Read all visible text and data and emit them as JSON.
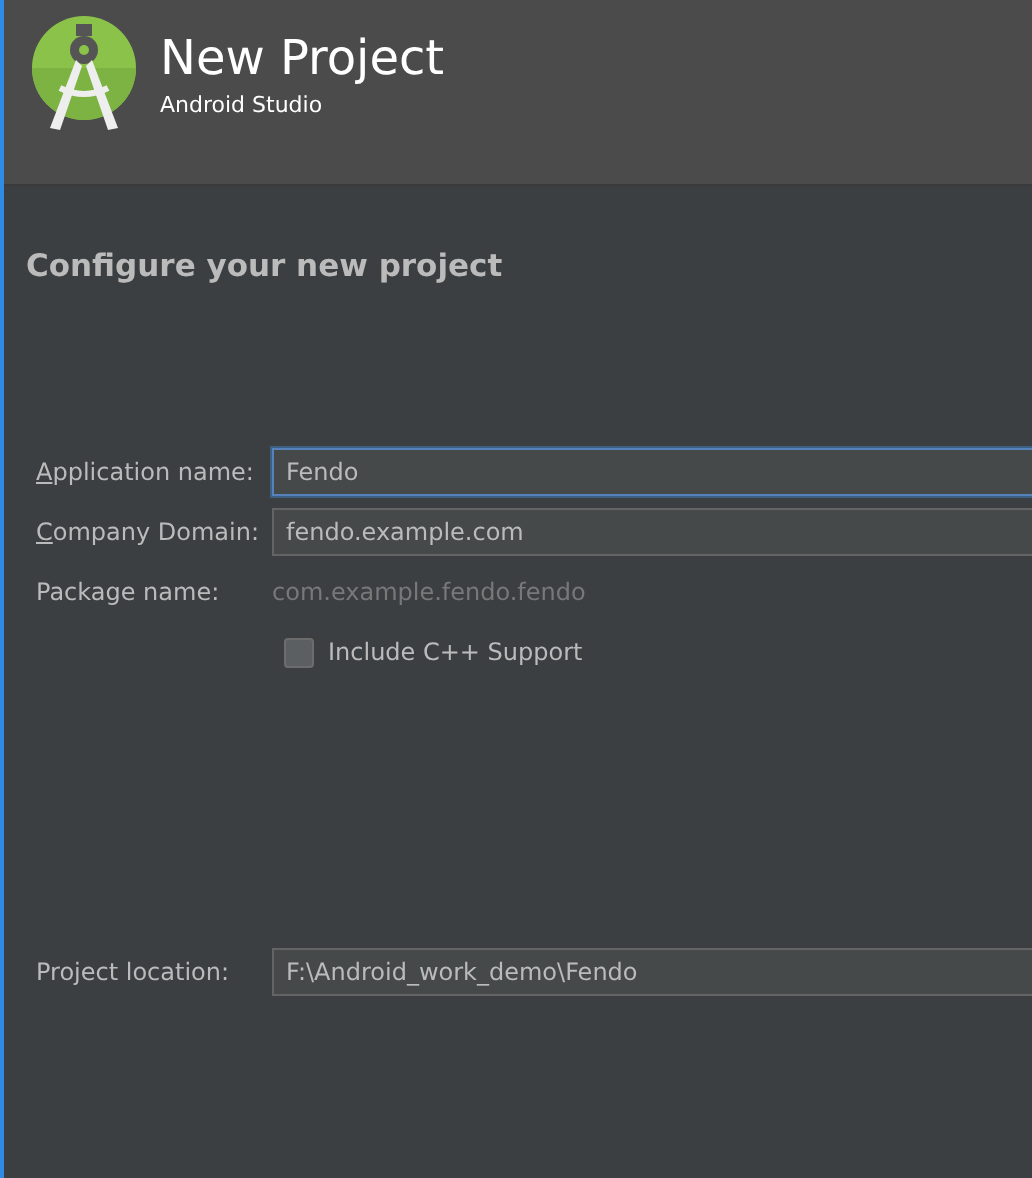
{
  "header": {
    "title": "New Project",
    "subtitle": "Android Studio"
  },
  "heading": "Configure your new project",
  "fields": [
    {
      "kind": "input",
      "label": "Application name:",
      "mnemonic": true,
      "value": "Fendo",
      "focused": true
    },
    {
      "kind": "input",
      "label": "Company Domain:",
      "mnemonic": true,
      "value": "fendo.example.com",
      "focused": false
    },
    {
      "kind": "text",
      "label": "Package name:",
      "mnemonic": false,
      "value": "com.example.fendo.fendo"
    }
  ],
  "checkbox": {
    "label": "Include C++ Support",
    "checked": false
  },
  "location": {
    "label": "Project location:",
    "value": "F:\\Android_work_demo\\Fendo",
    "focused": false
  }
}
